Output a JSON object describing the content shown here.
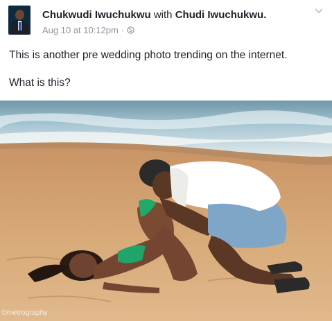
{
  "post": {
    "author": "Chukwudi Iwuchukwu",
    "with_word": "with",
    "tagged": "Chudi Iwuchukwu.",
    "timestamp": "Aug 10 at 10:12pm",
    "separator": "·",
    "privacy_icon": "globe-icon",
    "menu_icon": "chevron-down-icon",
    "text_line1": "This is another pre wedding photo trending on the internet.",
    "text_line2": "What is this?",
    "photo": {
      "subject": "beach pre-wedding photo",
      "watermark": "©metrography"
    }
  },
  "colors": {
    "text": "#1d2129",
    "meta": "#90949c",
    "sand": "#d7a978",
    "sea": "#a9c7d4"
  }
}
